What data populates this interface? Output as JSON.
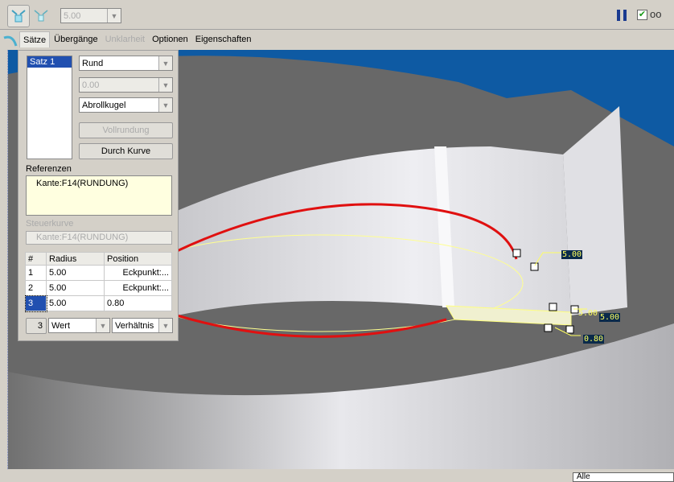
{
  "toolbar": {
    "radius_value": "5.00",
    "icons": [
      "set-mode-icon",
      "transition-mode-icon",
      "pause-icon",
      "check-icon",
      "glasses-icon"
    ]
  },
  "tabs": [
    {
      "label": "Sätze",
      "state": "selected"
    },
    {
      "label": "Übergänge",
      "state": "normal"
    },
    {
      "label": "Unklarheit",
      "state": "disabled"
    },
    {
      "label": "Optionen",
      "state": "normal"
    },
    {
      "label": "Eigenschaften",
      "state": "normal"
    }
  ],
  "panel": {
    "sets": [
      "Satz 1"
    ],
    "shape": "Rund",
    "value": "0.00",
    "method": "Abrollkugel",
    "full_round_label": "Vollrundung",
    "through_curve_label": "Durch Kurve",
    "references_label": "Referenzen",
    "references": [
      "Kante:F14(RUNDUNG)"
    ],
    "driving_curve_label": "Steuerkurve",
    "driving_curve": "Kante:F14(RUNDUNG)",
    "table": {
      "headers": [
        "#",
        "Radius",
        "Position"
      ],
      "rows": [
        [
          "1",
          "5.00",
          "Eckpunkt:..."
        ],
        [
          "2",
          "5.00",
          "Eckpunkt:..."
        ],
        [
          "3",
          "5.00",
          "0.80"
        ]
      ]
    },
    "footer": {
      "count": "3",
      "type": "Wert",
      "mode": "Verhältnis"
    }
  },
  "viewport": {
    "dims": [
      "5.00",
      "5.00",
      "5.00",
      "0.80"
    ]
  },
  "status": {
    "filter": "Alle"
  },
  "colors": {
    "background_blue": "#0e5aa3",
    "edge_red": "#e01010",
    "selection": "#2150b0",
    "dim_text": "#ffff60"
  }
}
